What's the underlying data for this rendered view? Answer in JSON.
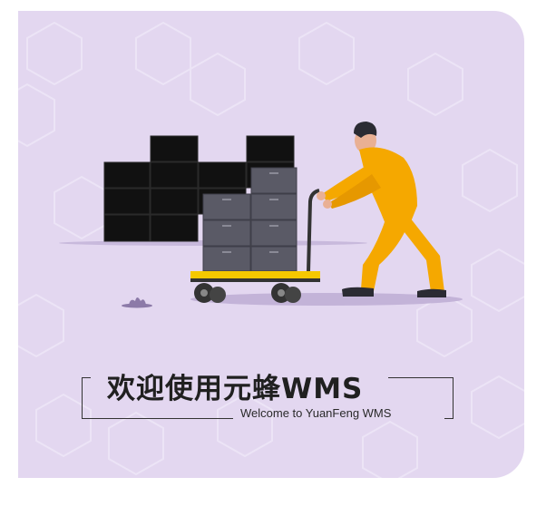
{
  "welcome": {
    "title": "欢迎使用元蜂WMS",
    "subtitle": "Welcome to YuanFeng WMS"
  },
  "colors": {
    "panel_background": "#e3d7f0",
    "worker_uniform": "#f5a800",
    "cart_platform": "#f5c800",
    "boxes": "#5a5a66",
    "stacked_crates": "#111111"
  },
  "illustration": {
    "name": "warehouse-worker-pushing-cart"
  }
}
